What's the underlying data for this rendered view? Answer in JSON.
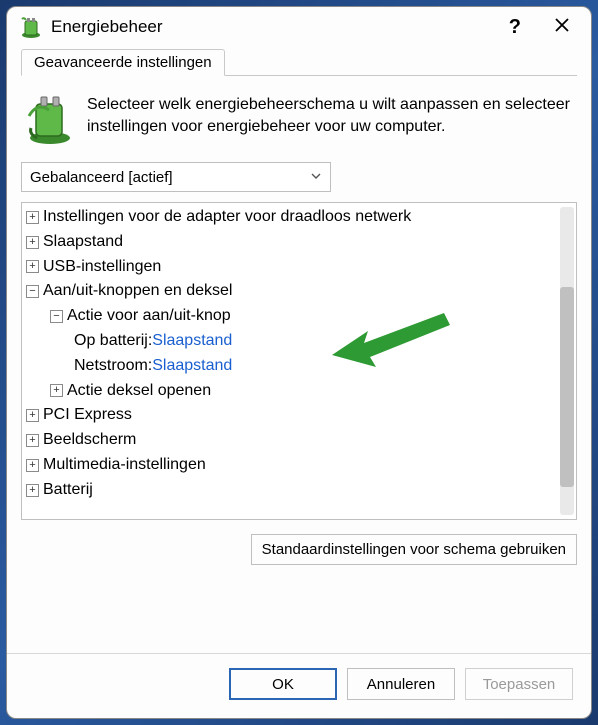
{
  "title": "Energiebeheer",
  "tab": "Geavanceerde instellingen",
  "intro": "Selecteer welk energiebeheerschema u wilt aanpassen en selecteer instellingen voor energiebeheer voor uw computer.",
  "dropdown": {
    "selected": "Gebalanceerd [actief]"
  },
  "tree": {
    "n0": "Instellingen voor de adapter voor draadloos netwerk",
    "n1": "Slaapstand",
    "n2": "USB-instellingen",
    "n3": "Aan/uit-knoppen en deksel",
    "n3a": "Actie voor aan/uit-knop",
    "n3a_bat_lbl": "Op batterij: ",
    "n3a_bat_val": "Slaapstand",
    "n3a_net_lbl": "Netstroom: ",
    "n3a_net_val": "Slaapstand",
    "n3b": "Actie deksel openen",
    "n4": "PCI Express",
    "n5": "Beeldscherm",
    "n6": "Multimedia-instellingen",
    "n7": "Batterij"
  },
  "restore": "Standaardinstellingen voor schema gebruiken",
  "buttons": {
    "ok": "OK",
    "cancel": "Annuleren",
    "apply": "Toepassen"
  }
}
